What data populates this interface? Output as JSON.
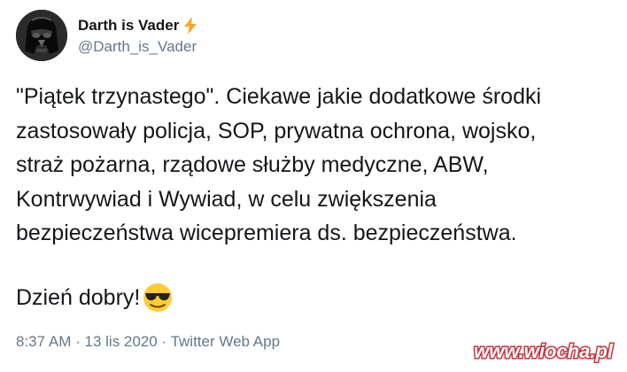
{
  "author": {
    "display_name": "Darth is Vader",
    "handle": "@Darth_is_Vader",
    "badge_icon": "lightning-icon",
    "avatar_icon": "darth-vader-helmet-avatar"
  },
  "tweet": {
    "lines": [
      "\"Piątek trzynastego\". Ciekawe jakie dodatkowe środki",
      "zastosowały policja, SOP, prywatna ochrona, wojsko,",
      "straż pożarna, rządowe służby medyczne, ABW,",
      "Kontrwywiad i Wywiad, w celu zwiększenia",
      "bezpieczeństwa wicepremiera ds. bezpieczeństwa."
    ],
    "greeting": "Dzień dobry!",
    "greeting_emoji": "sunglasses-emoji"
  },
  "meta": {
    "time": "8:37 AM",
    "separator": "·",
    "date": "13 lis 2020",
    "source": "Twitter Web App"
  },
  "watermark": {
    "text": "www.wiocha.pl"
  },
  "colors": {
    "text": "#14171a",
    "secondary": "#657786",
    "bolt": "#f5a623",
    "emoji": "#ffcc33",
    "watermark": "#c8323c"
  }
}
